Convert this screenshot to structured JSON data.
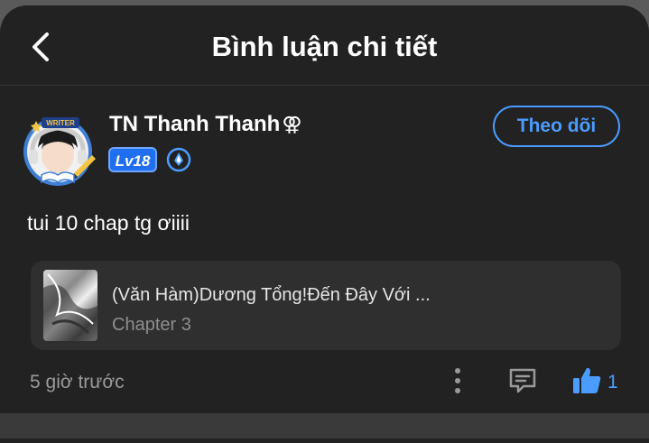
{
  "header": {
    "title": "Bình luận chi tiết"
  },
  "user": {
    "name": "TN Thanh Thanh",
    "gender_symbol": "⚢",
    "level": "Lv18",
    "avatar_badge": "WRITER"
  },
  "follow_button": {
    "label": "Theo dõi"
  },
  "comment": {
    "text": "tui 10 chap tg ơiiii"
  },
  "story": {
    "title": "(Văn Hàm)Dương Tổng!Đến Đây Với ...",
    "chapter": "Chapter 3"
  },
  "footer": {
    "time": "5 giờ trước",
    "like_count": "1"
  },
  "colors": {
    "accent": "#4b9cff",
    "background": "#222222",
    "card": "#2f2f2f"
  }
}
